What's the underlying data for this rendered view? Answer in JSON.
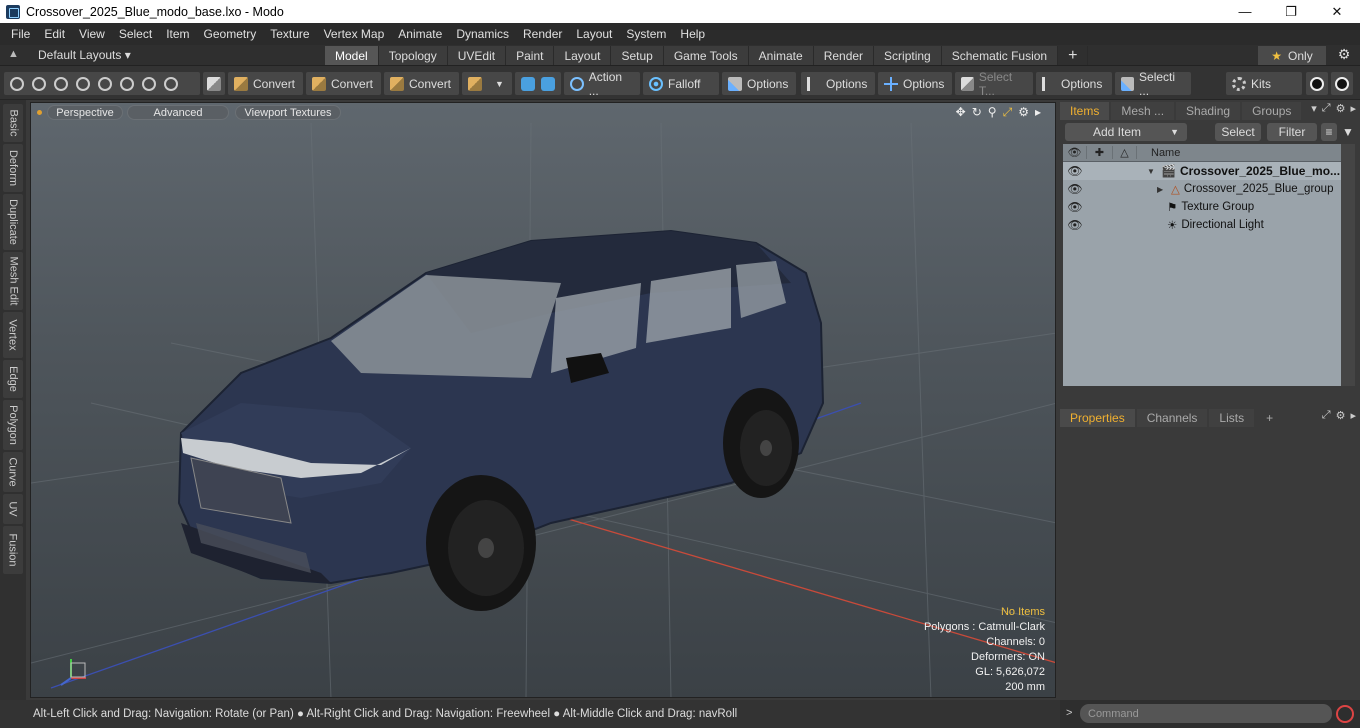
{
  "window": {
    "title": "Crossover_2025_Blue_modo_base.lxo - Modo"
  },
  "menu": [
    "File",
    "Edit",
    "View",
    "Select",
    "Item",
    "Geometry",
    "Texture",
    "Vertex Map",
    "Animate",
    "Dynamics",
    "Render",
    "Layout",
    "System",
    "Help"
  ],
  "layout_selector": "Default Layouts ▾",
  "layout_tabs": [
    "Model",
    "Topology",
    "UVEdit",
    "Paint",
    "Layout",
    "Setup",
    "Game Tools",
    "Animate",
    "Render",
    "Scripting",
    "Schematic Fusion"
  ],
  "active_layout_tab": "Model",
  "only_label": "Only",
  "toolbar": {
    "convert1": "Convert",
    "convert2": "Convert",
    "convert3": "Convert",
    "action": "Action  ...",
    "falloff": "Falloff",
    "options1": "Options",
    "options2": "Options",
    "options3": "Options",
    "select_t": "Select T...",
    "options4": "Options",
    "selecti": "Selecti ...",
    "kits": "Kits"
  },
  "left_tabs": [
    "Basic",
    "Deform",
    "Duplicate",
    "Mesh Edit",
    "Vertex",
    "Edge",
    "Polygon",
    "Curve",
    "UV",
    "Fusion"
  ],
  "viewport": {
    "view_mode": "Perspective",
    "shading": "Advanced",
    "textures": "Viewport Textures",
    "info": {
      "no_items": "No Items",
      "polygons": "Polygons : Catmull-Clark",
      "channels": "Channels: 0",
      "deformers": "Deformers: ON",
      "gl": "GL: 5,626,072",
      "scale": "200 mm"
    }
  },
  "items_panel": {
    "tabs": [
      "Items",
      "Mesh ...",
      "Shading",
      "Groups"
    ],
    "active_tab": "Items",
    "add_item": "Add Item",
    "select": "Select",
    "filter": "Filter",
    "column_name": "Name",
    "rows": [
      {
        "label": "Crossover_2025_Blue_mo...",
        "icon": "scene-icon"
      },
      {
        "label": "Crossover_2025_Blue_group",
        "icon": "group-locator-icon"
      },
      {
        "label": "Texture Group",
        "icon": "texture-group-icon"
      },
      {
        "label": "Directional Light",
        "icon": "light-icon"
      }
    ]
  },
  "properties_panel": {
    "tabs": [
      "Properties",
      "Channels",
      "Lists"
    ],
    "active_tab": "Properties"
  },
  "command": {
    "placeholder": "Command",
    "prompt": ">"
  },
  "status": "Alt-Left Click and Drag: Navigation: Rotate (or Pan) ● Alt-Right Click and Drag: Navigation: Freewheel ● Alt-Middle Click and Drag: navRoll",
  "colors": {
    "accent": "#f0b030",
    "viewport_top": "#5f676e",
    "viewport_bottom": "#3b4146",
    "car_body": "#2b3550"
  }
}
